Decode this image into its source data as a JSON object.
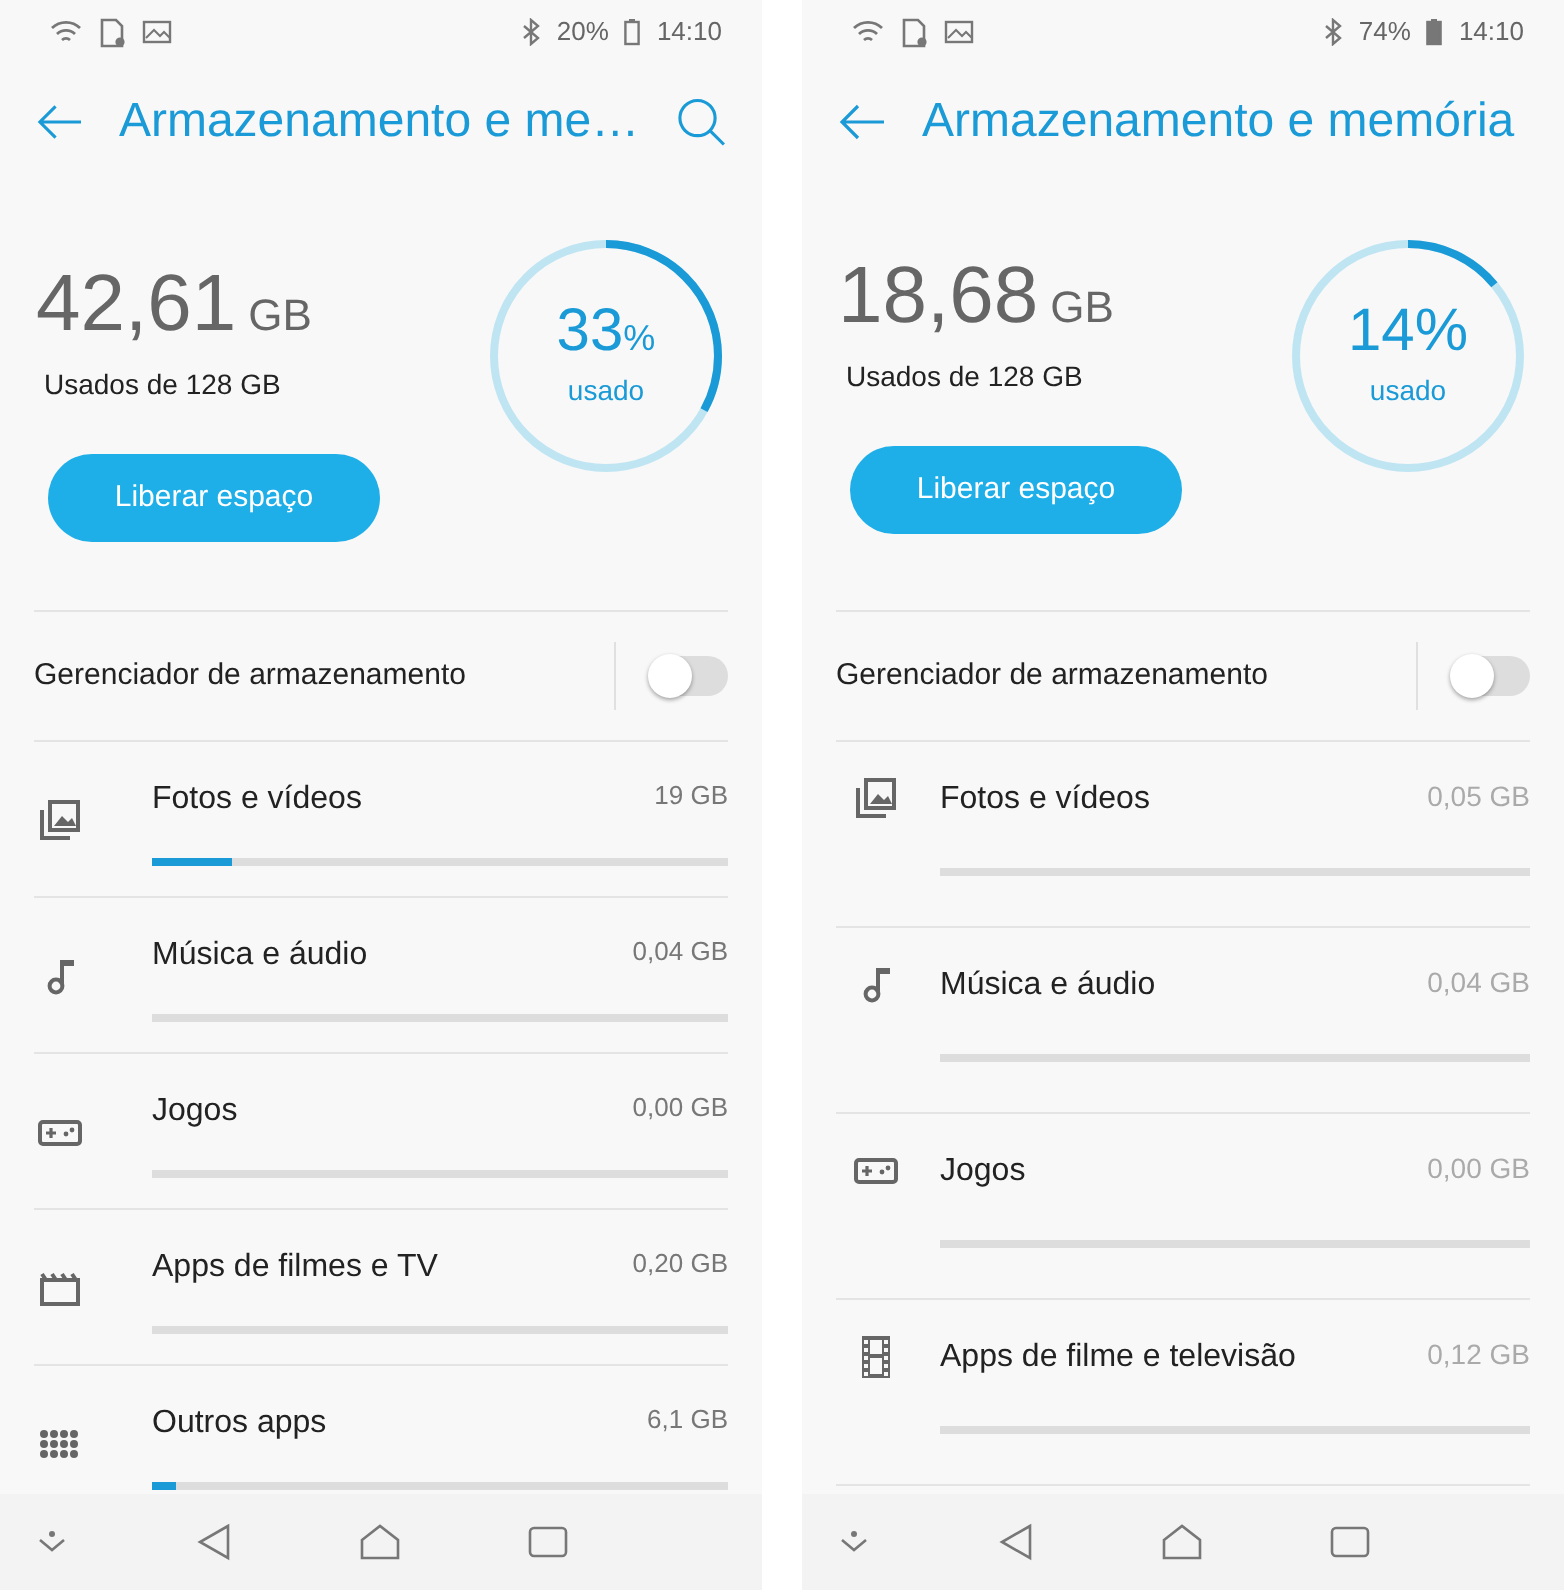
{
  "screens": [
    {
      "status_bar": {
        "battery": "20%",
        "time": "14:10"
      },
      "title": "Armazenamento e me…",
      "search_button": true,
      "storage": {
        "used": "42,61",
        "unit": "GB",
        "caption": "Usados de 128 GB",
        "percent_value": "33",
        "percent_unit": "%",
        "percent_label": "usado",
        "level": 0.33
      },
      "free_button": "Liberar espaço",
      "manager": {
        "label": "Gerenciador de armazenamento",
        "on": false
      },
      "categories": [
        {
          "kind": "photos",
          "label": "Fotos e vídeos",
          "size": "19 GB",
          "level": 0.14
        },
        {
          "kind": "music",
          "label": "Música e áudio",
          "size": "0,04 GB",
          "level": 0
        },
        {
          "kind": "games",
          "label": "Jogos",
          "size": "0,00 GB",
          "level": 0
        },
        {
          "kind": "movies",
          "label": "Apps de filmes e TV",
          "size": "0,20 GB",
          "level": 0
        },
        {
          "kind": "apps",
          "label": "Outros apps",
          "size": "6,1 GB",
          "level": 0.04
        }
      ]
    },
    {
      "status_bar": {
        "battery": "74%",
        "time": "14:10"
      },
      "title": "Armazenamento e memória",
      "search_button": false,
      "storage": {
        "used": "18,68",
        "unit": "GB",
        "caption": "Usados de 128 GB",
        "percent_value": "14",
        "percent_unit": "%",
        "percent_label": "usado",
        "level": 0.14
      },
      "free_button": "Liberar espaço",
      "manager": {
        "label": "Gerenciador de armazenamento",
        "on": false
      },
      "categories": [
        {
          "kind": "photos",
          "label": "Fotos e vídeos",
          "size": "0,05 GB",
          "level": 0
        },
        {
          "kind": "music",
          "label": "Música e áudio",
          "size": "0,04 GB",
          "level": 0
        },
        {
          "kind": "games",
          "label": "Jogos",
          "size": "0,00 GB",
          "level": 0
        },
        {
          "kind": "filmstrip",
          "label": "Apps de filme e televisão",
          "size": "0,12 GB",
          "level": 0
        }
      ]
    }
  ]
}
